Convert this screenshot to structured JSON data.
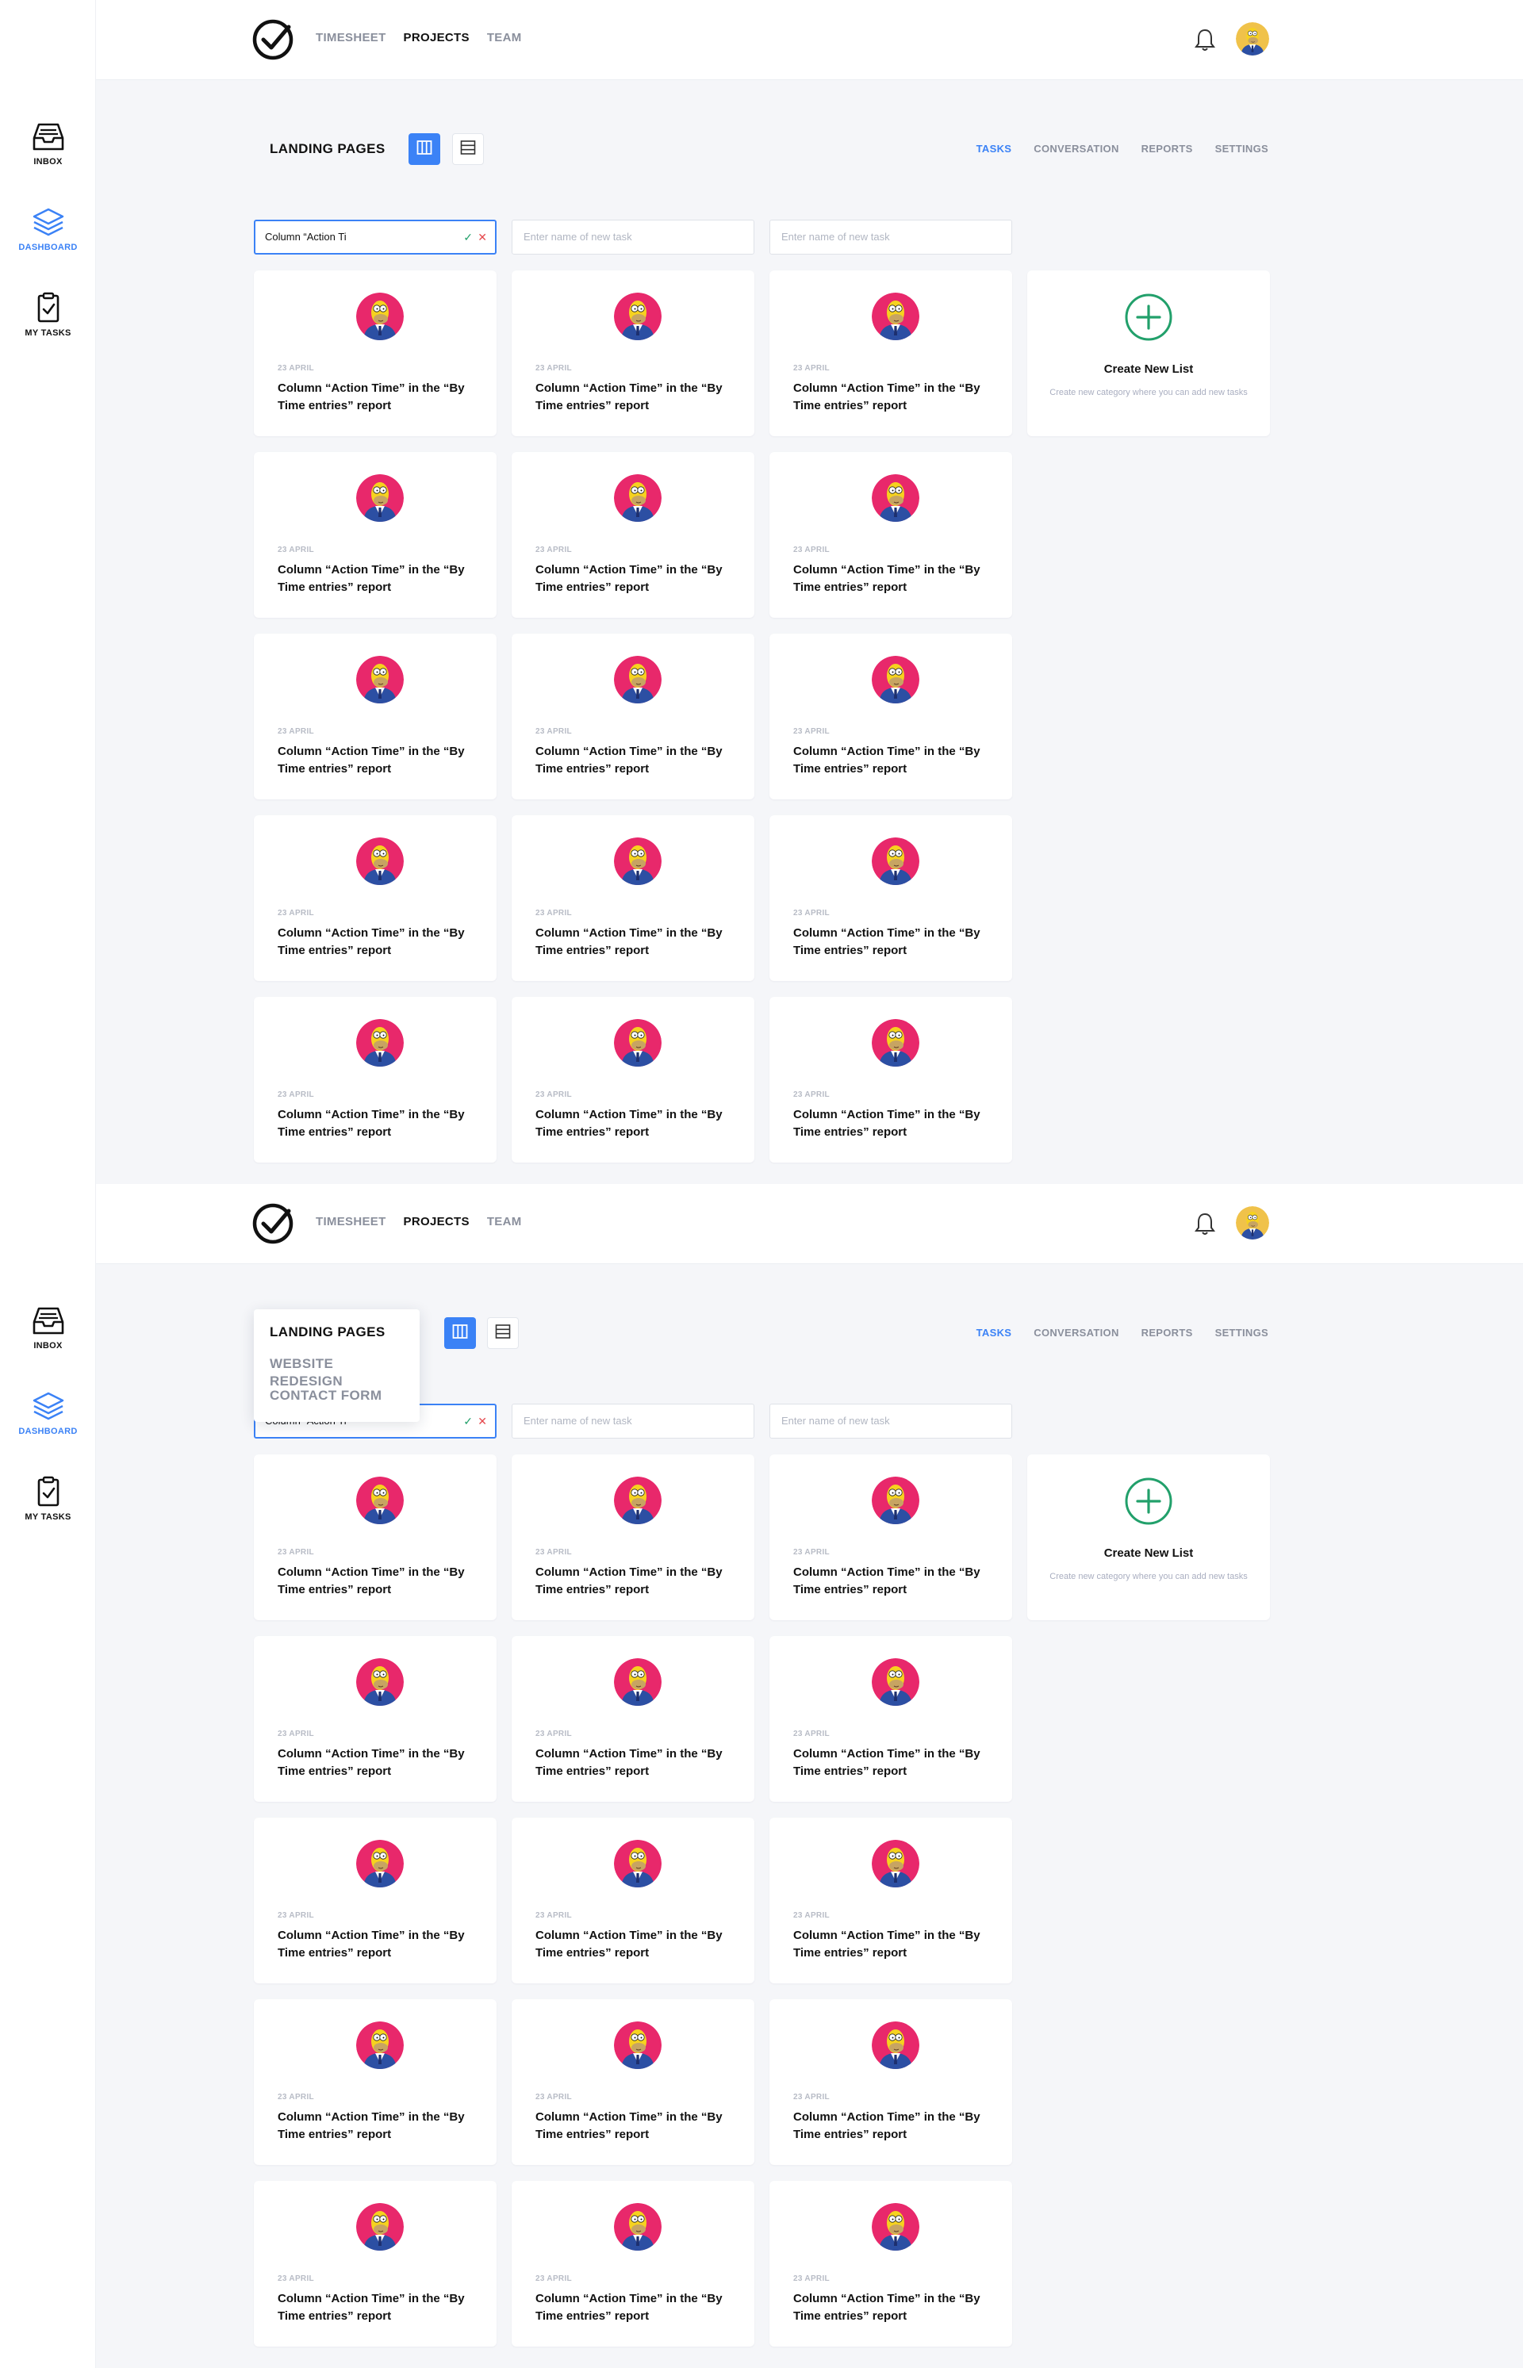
{
  "sidebar": {
    "items": [
      {
        "label": "INBOX",
        "icon": "inbox-icon"
      },
      {
        "label": "DASHBOARD",
        "icon": "layers-icon"
      },
      {
        "label": "MY TASKS",
        "icon": "clipboard-check-icon"
      }
    ]
  },
  "topnav": {
    "items": [
      "TIMESHEET",
      "PROJECTS",
      "TEAM"
    ],
    "active": "PROJECTS"
  },
  "project": {
    "title": "LANDING PAGES"
  },
  "tabs": {
    "items": [
      "TASKS",
      "CONVERSATION",
      "REPORTS",
      "SETTINGS"
    ],
    "active": "TASKS"
  },
  "columns": [
    {
      "input_value": "Column “Action Ti",
      "placeholder": "Enter name of new task"
    },
    {
      "input_value": "",
      "placeholder": "Enter name of new task"
    },
    {
      "input_value": "",
      "placeholder": "Enter name of new task"
    }
  ],
  "card": {
    "date": "23 APRIL",
    "title": "Column “Action Time” in the “By Time entries” report"
  },
  "create_list": {
    "title": "Create New List",
    "subtitle": "Create new category where you can add new tasks"
  },
  "project_dropdown": {
    "options": [
      "LANDING PAGES",
      "WEBSITE REDESIGN",
      "CONTACT FORM"
    ]
  },
  "colors": {
    "accent": "#3b82f6",
    "success": "#22a06b",
    "danger": "#e5484d"
  }
}
